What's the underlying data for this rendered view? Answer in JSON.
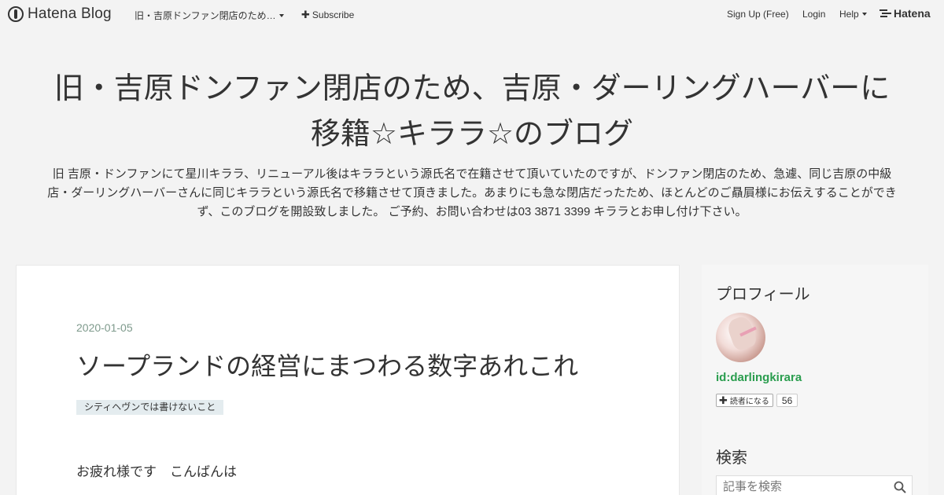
{
  "topbar": {
    "logo_text": "Hatena Blog",
    "blog_menu_label": "旧・吉原ドンファン閉店のため…",
    "subscribe_label": "Subscribe",
    "signup_label": "Sign Up (Free)",
    "login_label": "Login",
    "help_label": "Help",
    "hatena_text": "Hatena"
  },
  "header": {
    "title_line1": "旧・吉原ドンファン閉店のため、吉原・ダーリングハーバーに",
    "title_line2": "移籍☆キララ☆のブログ",
    "description": "旧 吉原・ドンファンにて星川キララ、リニューアル後はキララという源氏名で在籍させて頂いていたのですが、ドンファン閉店のため、急遽、同じ吉原の中級店・ダーリングハーバーさんに同じキララという源氏名で移籍させて頂きました。あまりにも急な閉店だったため、ほとんどのご贔屓様にお伝えすることができず、このブログを開設致しました。 ご予約、お問い合わせは03 3871 3399 キララとお申し付け下さい。"
  },
  "article": {
    "date": "2020-01-05",
    "title": "ソープランドの経営にまつわる数字あれこれ",
    "category": "シティヘヴンでは書けないこと",
    "body_first_line": "お疲れ様です　こんばんは"
  },
  "sidebar": {
    "profile_heading": "プロフィール",
    "user_id": "id:darlingkirara",
    "reader_button_label": "読者になる",
    "reader_count": "56",
    "search_heading": "検索",
    "search_placeholder": "記事を検索"
  }
}
